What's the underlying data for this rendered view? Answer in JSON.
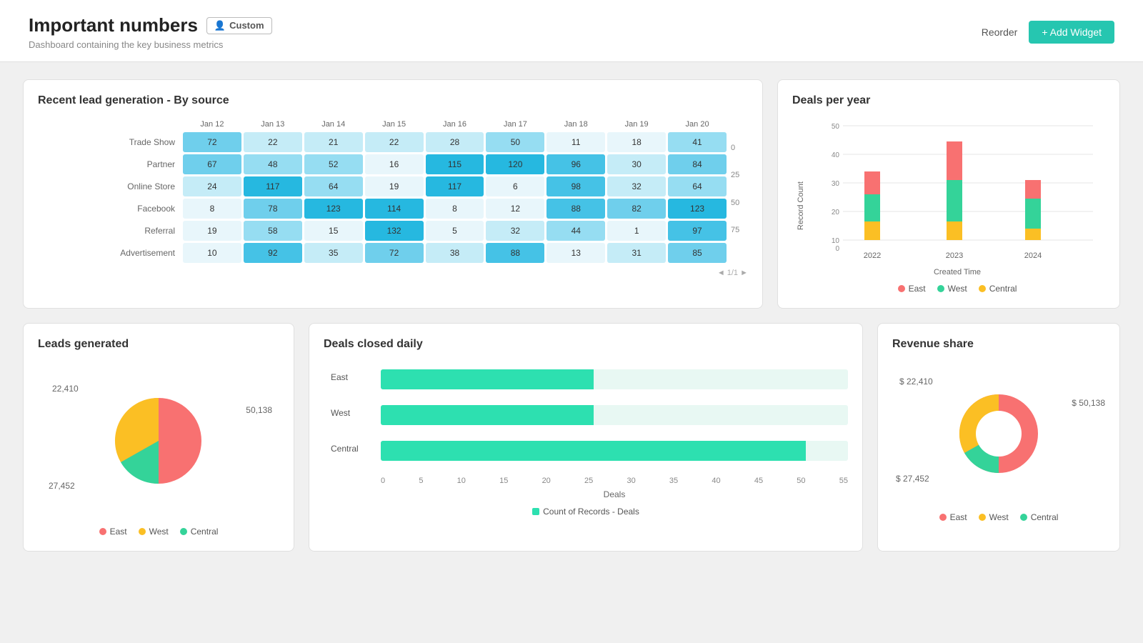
{
  "header": {
    "title": "Important numbers",
    "subtitle": "Dashboard containing the key business metrics",
    "custom_badge": "Custom",
    "reorder_label": "Reorder",
    "add_widget_label": "+ Add Widget"
  },
  "lead_gen": {
    "title": "Recent lead generation - By source",
    "rows": [
      {
        "label": "Trade Show",
        "cells": [
          72,
          22,
          21,
          22,
          28,
          50,
          11,
          18,
          41
        ]
      },
      {
        "label": "Partner",
        "cells": [
          67,
          48,
          52,
          16,
          115,
          120,
          96,
          30,
          84
        ]
      },
      {
        "label": "Online Store",
        "cells": [
          24,
          117,
          64,
          19,
          117,
          6,
          98,
          32,
          64
        ]
      },
      {
        "label": "Facebook",
        "cells": [
          8,
          78,
          123,
          114,
          8,
          12,
          88,
          82,
          123
        ]
      },
      {
        "label": "Referral",
        "cells": [
          19,
          58,
          15,
          132,
          5,
          32,
          44,
          1,
          97
        ]
      },
      {
        "label": "Advertisement",
        "cells": [
          10,
          92,
          35,
          72,
          38,
          88,
          13,
          31,
          85
        ]
      }
    ],
    "headers": [
      "Jan 12",
      "Jan 13",
      "Jan 14",
      "Jan 15",
      "Jan 16",
      "Jan 17",
      "Jan 18",
      "Jan 19",
      "Jan 20"
    ],
    "scale_labels": [
      "0",
      "25",
      "50",
      "75"
    ],
    "pagination": "◄1/1►"
  },
  "deals_year": {
    "title": "Deals per year",
    "axis_label": "Created Time",
    "y_label": "Record Count",
    "years": [
      "2022",
      "2023",
      "2024"
    ],
    "bars": {
      "2022": {
        "east": 10,
        "west": 12,
        "central": 3
      },
      "2023": {
        "east": 17,
        "west": 18,
        "central": 8
      },
      "2024": {
        "east": 8,
        "west": 13,
        "central": 3
      }
    },
    "y_ticks": [
      0,
      10,
      20,
      30,
      40,
      50
    ],
    "legend": [
      "East",
      "West",
      "Central"
    ],
    "colors": {
      "east": "#f87171",
      "west": "#34d399",
      "central": "#fbbf24"
    }
  },
  "leads_gen": {
    "title": "Leads generated",
    "values": {
      "east": 50138,
      "west": 27452,
      "central": 22410
    },
    "labels_outside": [
      "22,410",
      "50,138",
      "27,452"
    ],
    "legend": [
      "East",
      "West",
      "Central"
    ],
    "colors": {
      "east": "#f87171",
      "west": "#fbbf24",
      "central": "#34d399"
    }
  },
  "deals_daily": {
    "title": "Deals closed daily",
    "rows": [
      {
        "label": "East",
        "value": 25,
        "max": 55
      },
      {
        "label": "West",
        "value": 25,
        "max": 55
      },
      {
        "label": "Central",
        "value": 50,
        "max": 55
      }
    ],
    "x_ticks": [
      0,
      5,
      10,
      15,
      20,
      25,
      30,
      35,
      40,
      45,
      50,
      55
    ],
    "x_label": "Deals",
    "legend_label": "Count of Records - Deals",
    "color": "#2de0b0"
  },
  "revenue": {
    "title": "Revenue share",
    "values": {
      "east": 50138,
      "west": 27452,
      "central": 22410
    },
    "labels_outside": [
      "$ 22,410",
      "$ 50,138",
      "$ 27,452"
    ],
    "legend": [
      "East",
      "West",
      "Central"
    ],
    "colors": {
      "east": "#f87171",
      "west": "#fbbf24",
      "central": "#34d399"
    }
  }
}
